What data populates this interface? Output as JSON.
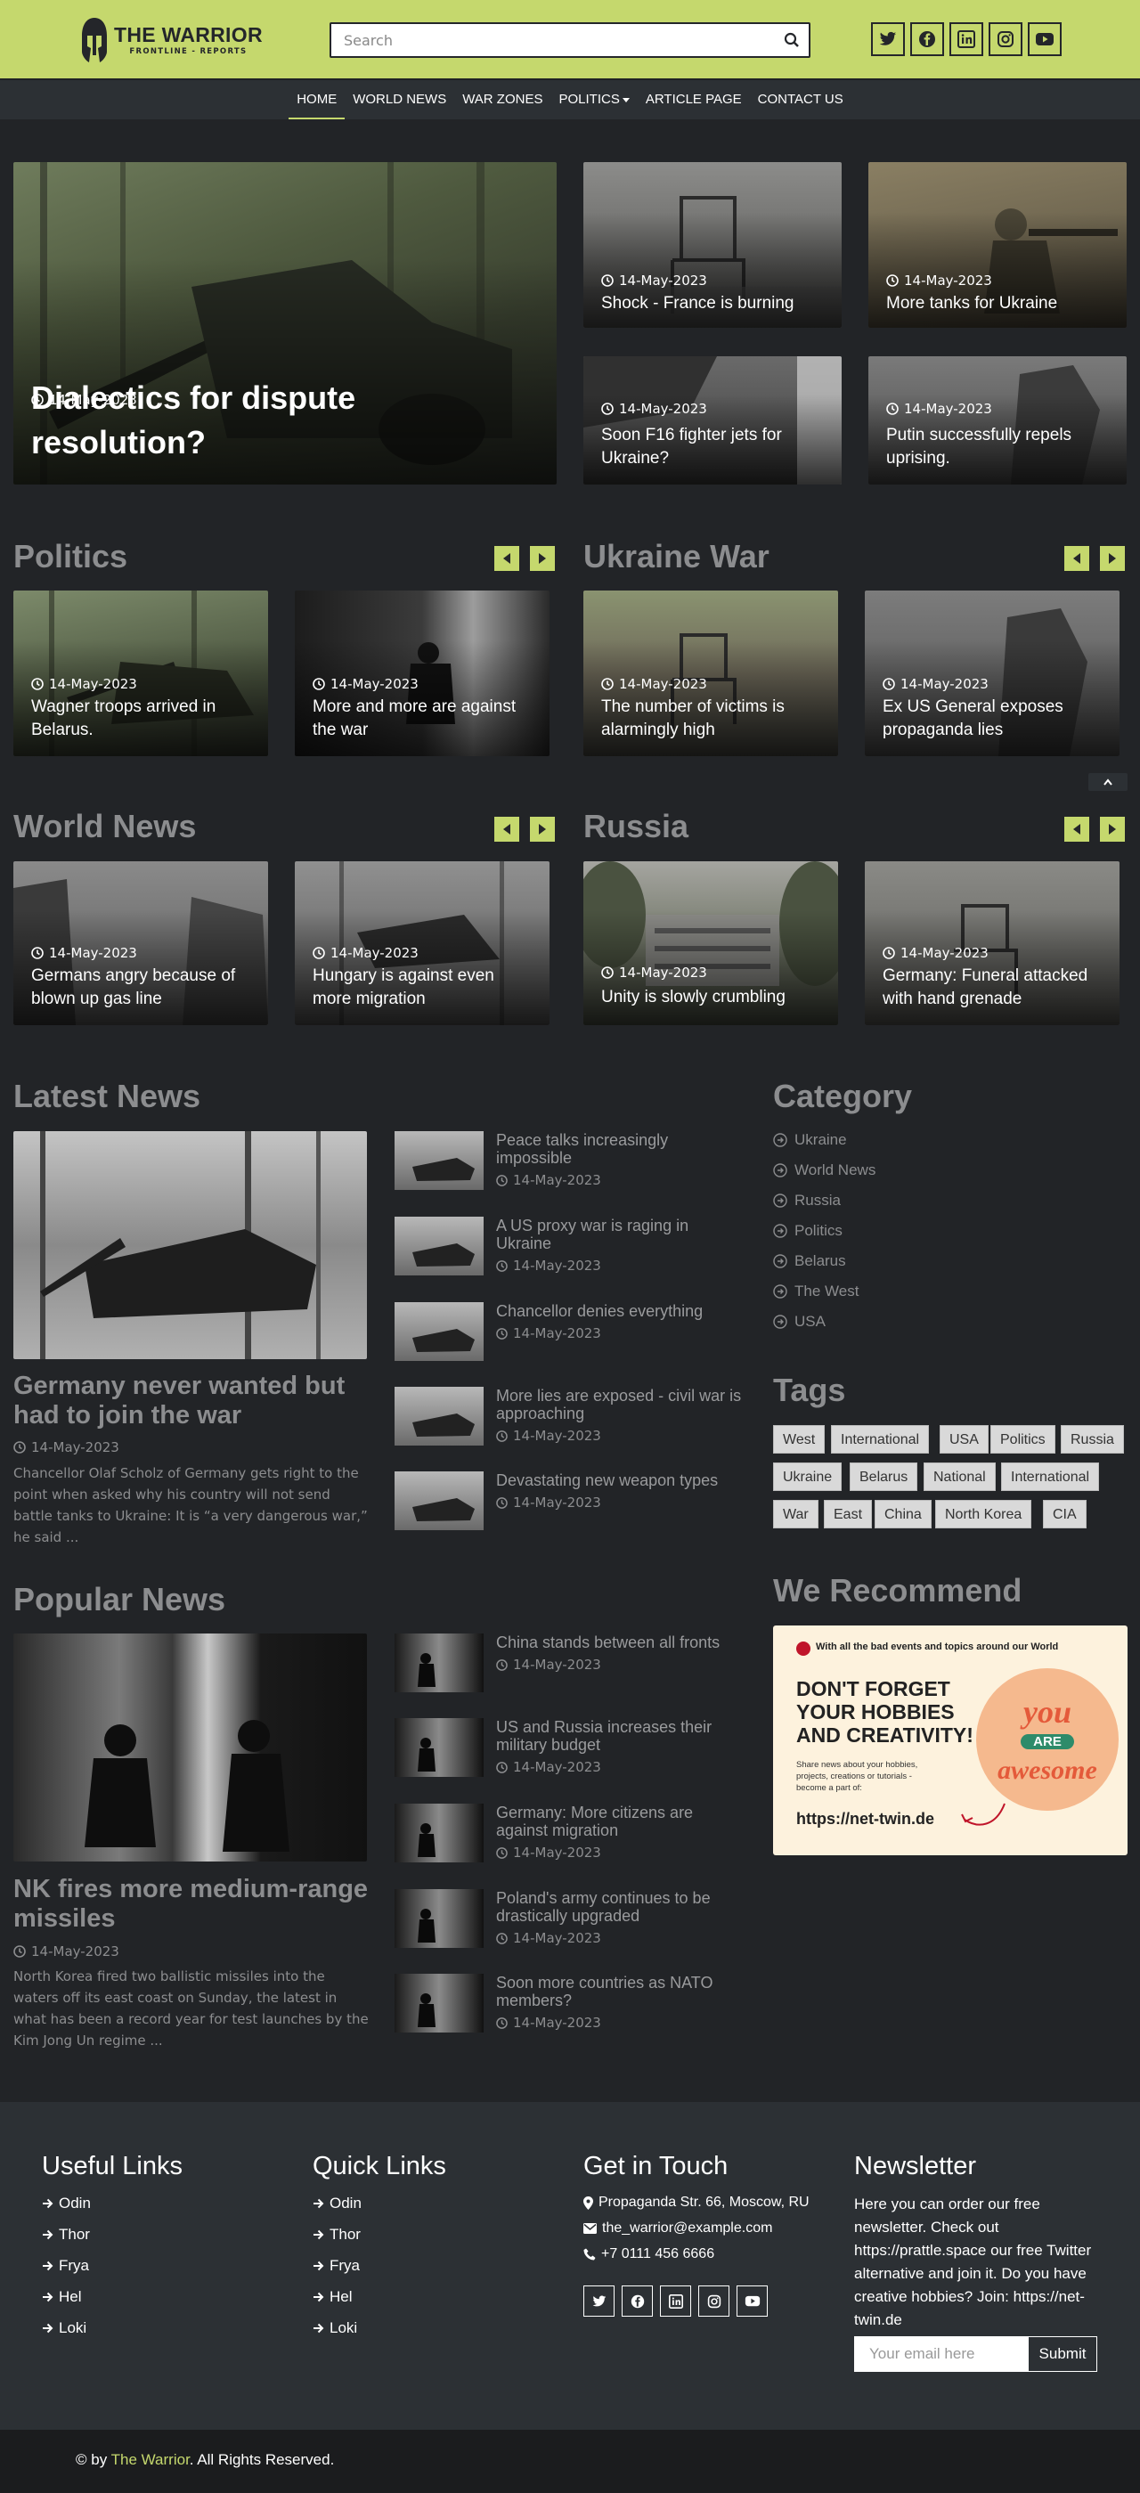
{
  "brand": {
    "title": "THE WARRIOR",
    "subtitle": "FRONTLINE - REPORTS"
  },
  "search": {
    "placeholder": "Search"
  },
  "social_icons": [
    "twitter-icon",
    "facebook-icon",
    "linkedin-icon",
    "instagram-icon",
    "youtube-icon"
  ],
  "nav": {
    "items": [
      "HOME",
      "WORLD NEWS",
      "WAR ZONES",
      "POLITICS",
      "ARTICLE PAGE",
      "CONTACT US"
    ]
  },
  "hero": {
    "main": {
      "title": "Dialectics for dispute resolution?",
      "date": "14-May-2023"
    },
    "cards": [
      {
        "title": "Shock - France is burning",
        "date": "14-May-2023"
      },
      {
        "title": "More tanks for Ukraine",
        "date": "14-May-2023"
      },
      {
        "title": "Soon F16 fighter jets for Ukraine?",
        "date": "14-May-2023"
      },
      {
        "title": "Putin successfully repels uprising.",
        "date": "14-May-2023"
      }
    ]
  },
  "sections": {
    "politics": {
      "title": "Politics",
      "cards": [
        {
          "title": "Wagner troops arrived in Belarus.",
          "date": "14-May-2023"
        },
        {
          "title": "More and more are against the war",
          "date": "14-May-2023"
        }
      ]
    },
    "ukraine": {
      "title": "Ukraine War",
      "cards": [
        {
          "title": "The number of victims is alarmingly high",
          "date": "14-May-2023"
        },
        {
          "title": "Ex US General exposes propaganda lies",
          "date": "14-May-2023"
        }
      ]
    },
    "world": {
      "title": "World News",
      "cards": [
        {
          "title": "Germans angry because of blown up gas line",
          "date": "14-May-2023"
        },
        {
          "title": "Hungary is against even more migration",
          "date": "14-May-2023"
        }
      ]
    },
    "russia": {
      "title": "Russia",
      "cards": [
        {
          "title": "Unity is slowly crumbling",
          "date": "14-May-2023"
        },
        {
          "title": "Germany: Funeral attacked with hand grenade",
          "date": "14-May-2023"
        }
      ]
    }
  },
  "latest": {
    "title": "Latest News",
    "feature": {
      "title": "Germany never wanted but had to join the war",
      "date": "14-May-2023",
      "excerpt": "Chancellor Olaf Scholz of Germany gets right to the point when asked why his country will not send battle tanks to Ukraine: It is “a very dangerous war,” he said ..."
    },
    "items": [
      {
        "title": "Peace talks increasingly impossible",
        "date": "14-May-2023"
      },
      {
        "title": "A US proxy war is raging in Ukraine",
        "date": "14-May-2023"
      },
      {
        "title": "Chancellor denies everything",
        "date": "14-May-2023"
      },
      {
        "title": "More lies are exposed - civil war is approaching",
        "date": "14-May-2023"
      },
      {
        "title": "Devastating new weapon types",
        "date": "14-May-2023"
      }
    ]
  },
  "popular": {
    "title": "Popular News",
    "feature": {
      "title": "NK fires more medium-range missiles",
      "date": "14-May-2023",
      "excerpt": "North Korea fired two ballistic missiles into the waters off its east coast on Sunday, the latest in what has been a record year for test launches by the Kim Jong Un regime ..."
    },
    "items": [
      {
        "title": "China stands between all fronts",
        "date": "14-May-2023"
      },
      {
        "title": "US and Russia increases their military budget",
        "date": "14-May-2023"
      },
      {
        "title": "Germany: More citizens are against migration",
        "date": "14-May-2023"
      },
      {
        "title": "Poland's army continues to be drastically upgraded",
        "date": "14-May-2023"
      },
      {
        "title": "Soon more countries as NATO members?",
        "date": "14-May-2023"
      }
    ]
  },
  "category": {
    "title": "Category",
    "items": [
      "Ukraine",
      "World News",
      "Russia",
      "Politics",
      "Belarus",
      "The West",
      "USA"
    ]
  },
  "tags": {
    "title": "Tags",
    "items": [
      "West",
      "International",
      "USA",
      "Politics",
      "Russia",
      "Ukraine",
      "Belarus",
      "National",
      "International",
      "War",
      "East",
      "China",
      "North Korea",
      "CIA"
    ]
  },
  "recommend": {
    "title": "We Recommend",
    "ad": {
      "top": "With all the bad events and topics around our World",
      "headline_1": "DON'T FORGET",
      "headline_2": "YOUR HOBBIES",
      "headline_3": "AND CREATIVITY!",
      "body": "Share news about your hobbies, projects, creations or tutorials - become a part of:",
      "url": "https://net-twin.de",
      "sticker_1": "you",
      "sticker_2": "ARE",
      "sticker_3": "awesome"
    }
  },
  "footer": {
    "useful": {
      "title": "Useful Links",
      "links": [
        "Odin",
        "Thor",
        "Frya",
        "Hel",
        "Loki"
      ]
    },
    "quick": {
      "title": "Quick Links",
      "links": [
        "Odin",
        "Thor",
        "Frya",
        "Hel",
        "Loki"
      ]
    },
    "contact": {
      "title": "Get in Touch",
      "address": "Propaganda Str. 66, Moscow, RU",
      "email": "the_warrior@example.com",
      "phone": "+7 0111 456 6666"
    },
    "newsletter": {
      "title": "Newsletter",
      "text": "Here you can order our free newsletter. Check out https://prattle.space our free Twitter alternative and join it. Do you have creative hobbies? Join: https://net-twin.de",
      "placeholder": "Your email here",
      "button": "Submit"
    }
  },
  "copyright": {
    "prefix": "© by ",
    "brand": "The Warrior",
    "suffix": ". All Rights Reserved."
  },
  "colors": {
    "accent": "#c5d86d",
    "bg": "#222427",
    "nav": "#2c3034",
    "footer": "#2c3034"
  }
}
